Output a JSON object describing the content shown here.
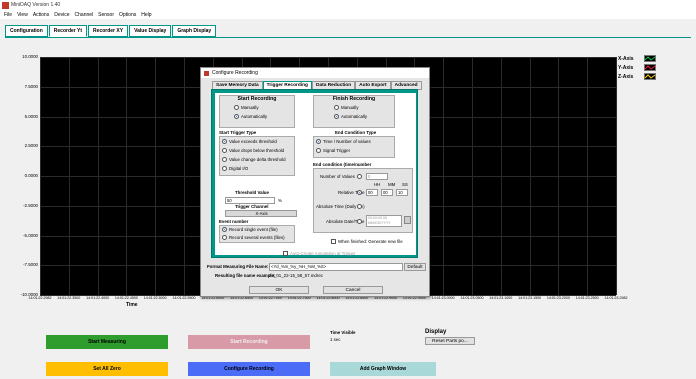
{
  "window": {
    "title": "MiniDAQ Version 1.40"
  },
  "menu": [
    "File",
    "View",
    "Actions",
    "Device",
    "Channel",
    "Sensor",
    "Options",
    "Help"
  ],
  "tabs": [
    "Configuration",
    "Recorder Yt",
    "Recorder XY",
    "Value Display",
    "Graph Display"
  ],
  "plot": {
    "y_ticks": [
      "10.0000",
      "7.5000",
      "5.0000",
      "2.5000",
      "0.0000",
      "-2.5000",
      "-5.0000",
      "-7.5000",
      "-10.0000"
    ],
    "x_ticks": [
      "14:01:22.2982",
      "14:01:22.3500",
      "14:01:22.4000",
      "14:01:22.4500",
      "14:01:22.5000",
      "14:01:22.5500",
      "14:01:22.6000",
      "14:01:22.6500",
      "14:01:22.7000",
      "14:01:22.7500",
      "14:01:22.8000",
      "14:01:22.8500",
      "14:01:22.9000",
      "14:01:22.9500",
      "14:01:23.0000",
      "14:01:23.0500",
      "14:01:23.1000",
      "14:01:23.1500",
      "14:01:23.2000",
      "14:01:23.2500",
      "14:01:23.2982"
    ],
    "x_title": "Time",
    "legend": [
      "X-Axis",
      "Y-Axis",
      "Z-Axis"
    ],
    "legend_colors": [
      "#00c853",
      "#ff1744",
      "#ffd600"
    ]
  },
  "dialog": {
    "title": "Configure Recording",
    "tabs": [
      "Save Memory Data",
      "Trigger Recording",
      "Data Reduction",
      "Auto Export",
      "Advanced"
    ],
    "start": {
      "header": "Start Recording",
      "manual": "Manually",
      "auto": "Automatically",
      "trigger_type": "Start Trigger Type",
      "types": [
        "Value exceeds threshold",
        "Value drops below threshold",
        "Value change delta threshold",
        "Digital I/O"
      ],
      "threshold_label": "Threshold Value",
      "threshold_value": "50",
      "threshold_unit": "%",
      "trigger_channel_label": "Trigger Channel",
      "trigger_channel": "X-Axis",
      "event_label": "Event number",
      "event_single": "Record single event (file)",
      "event_several": "Record several events (files)"
    },
    "finish": {
      "header": "Finish Recording",
      "manual": "Manually",
      "auto": "Automatically",
      "cond_label": "End Condition Type",
      "cond_time": "Time / Number of values",
      "cond_signal": "Signal Trigger",
      "end_cond_label": "End condition (time/number",
      "num_values": "Number of Values",
      "num_values_val": "0",
      "relative_time": "Relative Time",
      "hh": "HH",
      "mm": "MM",
      "ss": "SS",
      "hh_val": "00",
      "mm_val": "00",
      "ss_val": "10",
      "abs_daily": "Absolute Time (Daily file)",
      "abs_dt": "Absolute Date/Time",
      "abs_date_val": "00:00:00.00",
      "abs_date_val2": "MM/DD/YYYY",
      "when_finished": "When finished: Generate new file"
    },
    "autocreate": "Auto-Create Annotation at Trigger",
    "format_label": "Format Measuring File Name:",
    "format_value": "<Yd_%m_%y_%H_%M_%S>",
    "default_btn": "Default",
    "example_label": "Resulting file name example:",
    "example_value": "24_01_22-15_58_57.mdrec",
    "ok": "OK",
    "cancel": "Cancel"
  },
  "bottom": {
    "start_measuring": "Start Measuring",
    "start_recording": "Start Recording",
    "time_visible_label": "Time Visible",
    "time_visible_val": "1 sec",
    "display_label": "Display",
    "reset_parts": "Reset Parts po...",
    "set_all_zero": "Set All Zero",
    "configure_recording": "Configure Recording",
    "add_graph": "Add Graph Window"
  }
}
